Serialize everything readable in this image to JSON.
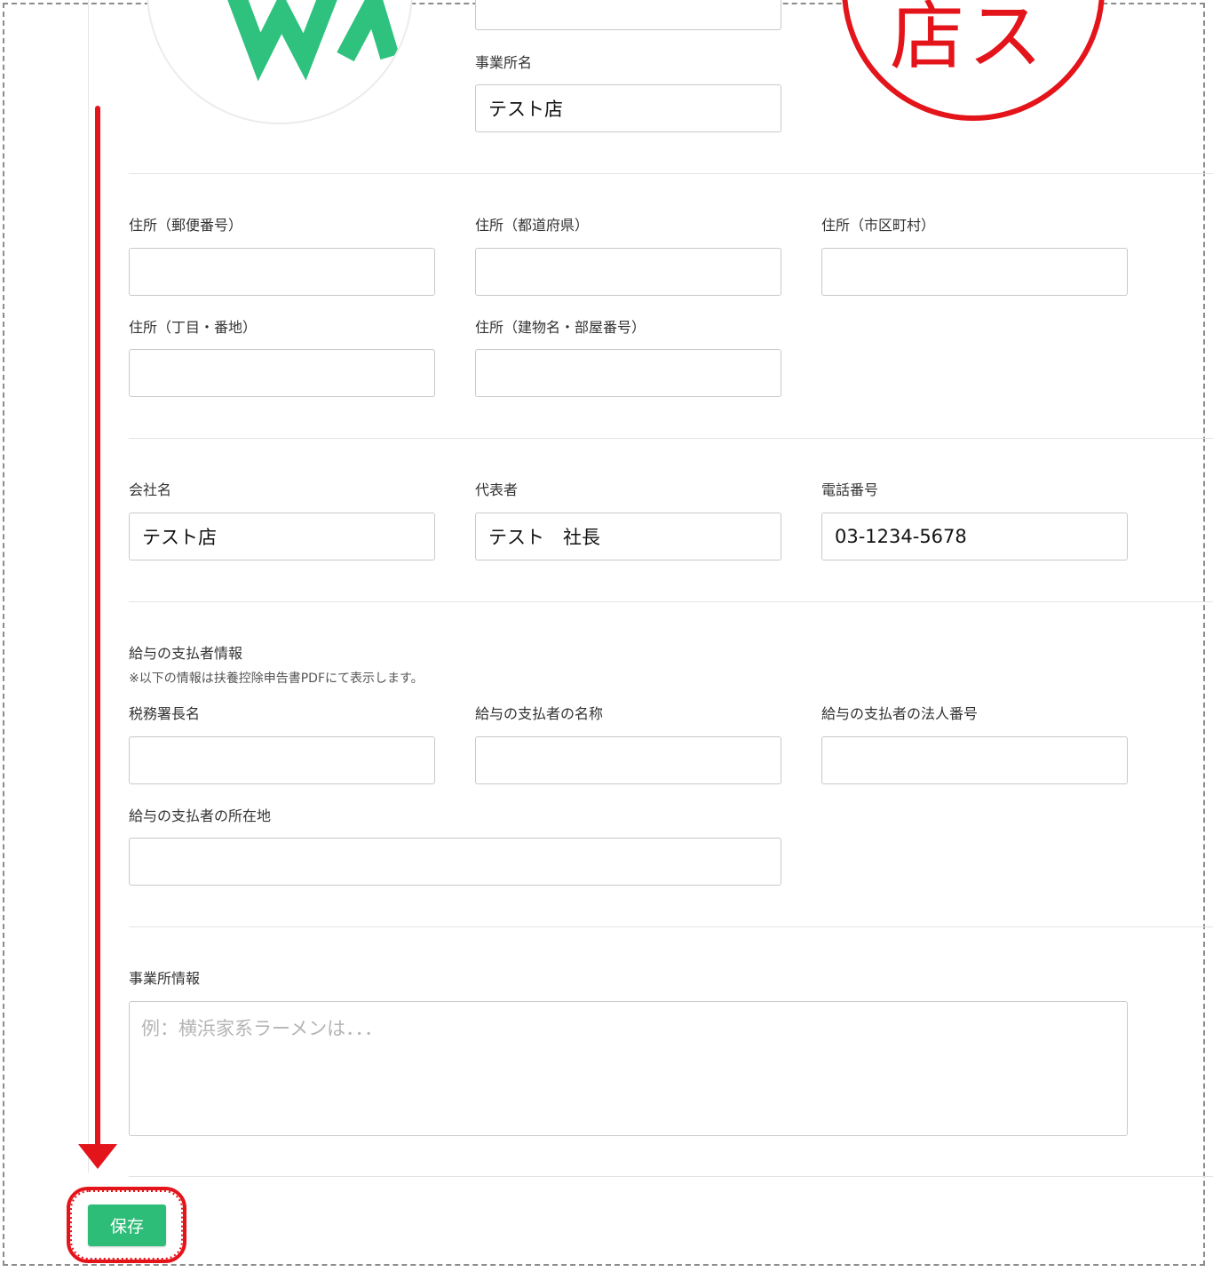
{
  "header_block": {
    "office_name_label": "事業所名",
    "office_name_value": "テスト店",
    "seal_text": "店ス",
    "logo_text": "WA"
  },
  "address": {
    "postal_label": "住所（郵便番号）",
    "prefecture_label": "住所（都道府県）",
    "city_label": "住所（市区町村）",
    "street_label": "住所（丁目・番地）",
    "building_label": "住所（建物名・部屋番号）",
    "postal_value": "",
    "prefecture_value": "",
    "city_value": "",
    "street_value": "",
    "building_value": ""
  },
  "company": {
    "company_name_label": "会社名",
    "company_name_value": "テスト店",
    "representative_label": "代表者",
    "representative_value": "テスト　社長",
    "phone_label": "電話番号",
    "phone_value": "03-1234-5678"
  },
  "payer": {
    "section_title": "給与の支払者情報",
    "note": "※以下の情報は扶養控除申告書PDFにて表示します。",
    "tax_office_label": "税務署長名",
    "payer_name_label": "給与の支払者の名称",
    "corporate_number_label": "給与の支払者の法人番号",
    "payer_address_label": "給与の支払者の所在地",
    "tax_office_value": "",
    "payer_name_value": "",
    "corporate_number_value": "",
    "payer_address_value": ""
  },
  "office_info": {
    "label": "事業所情報",
    "placeholder": "例：横浜家系ラーメンは．．．"
  },
  "actions": {
    "save_label": "保存"
  },
  "colors": {
    "accent_green": "#2ebd78",
    "annotation_red": "#e4141b",
    "logo_green": "#2ec27e"
  }
}
